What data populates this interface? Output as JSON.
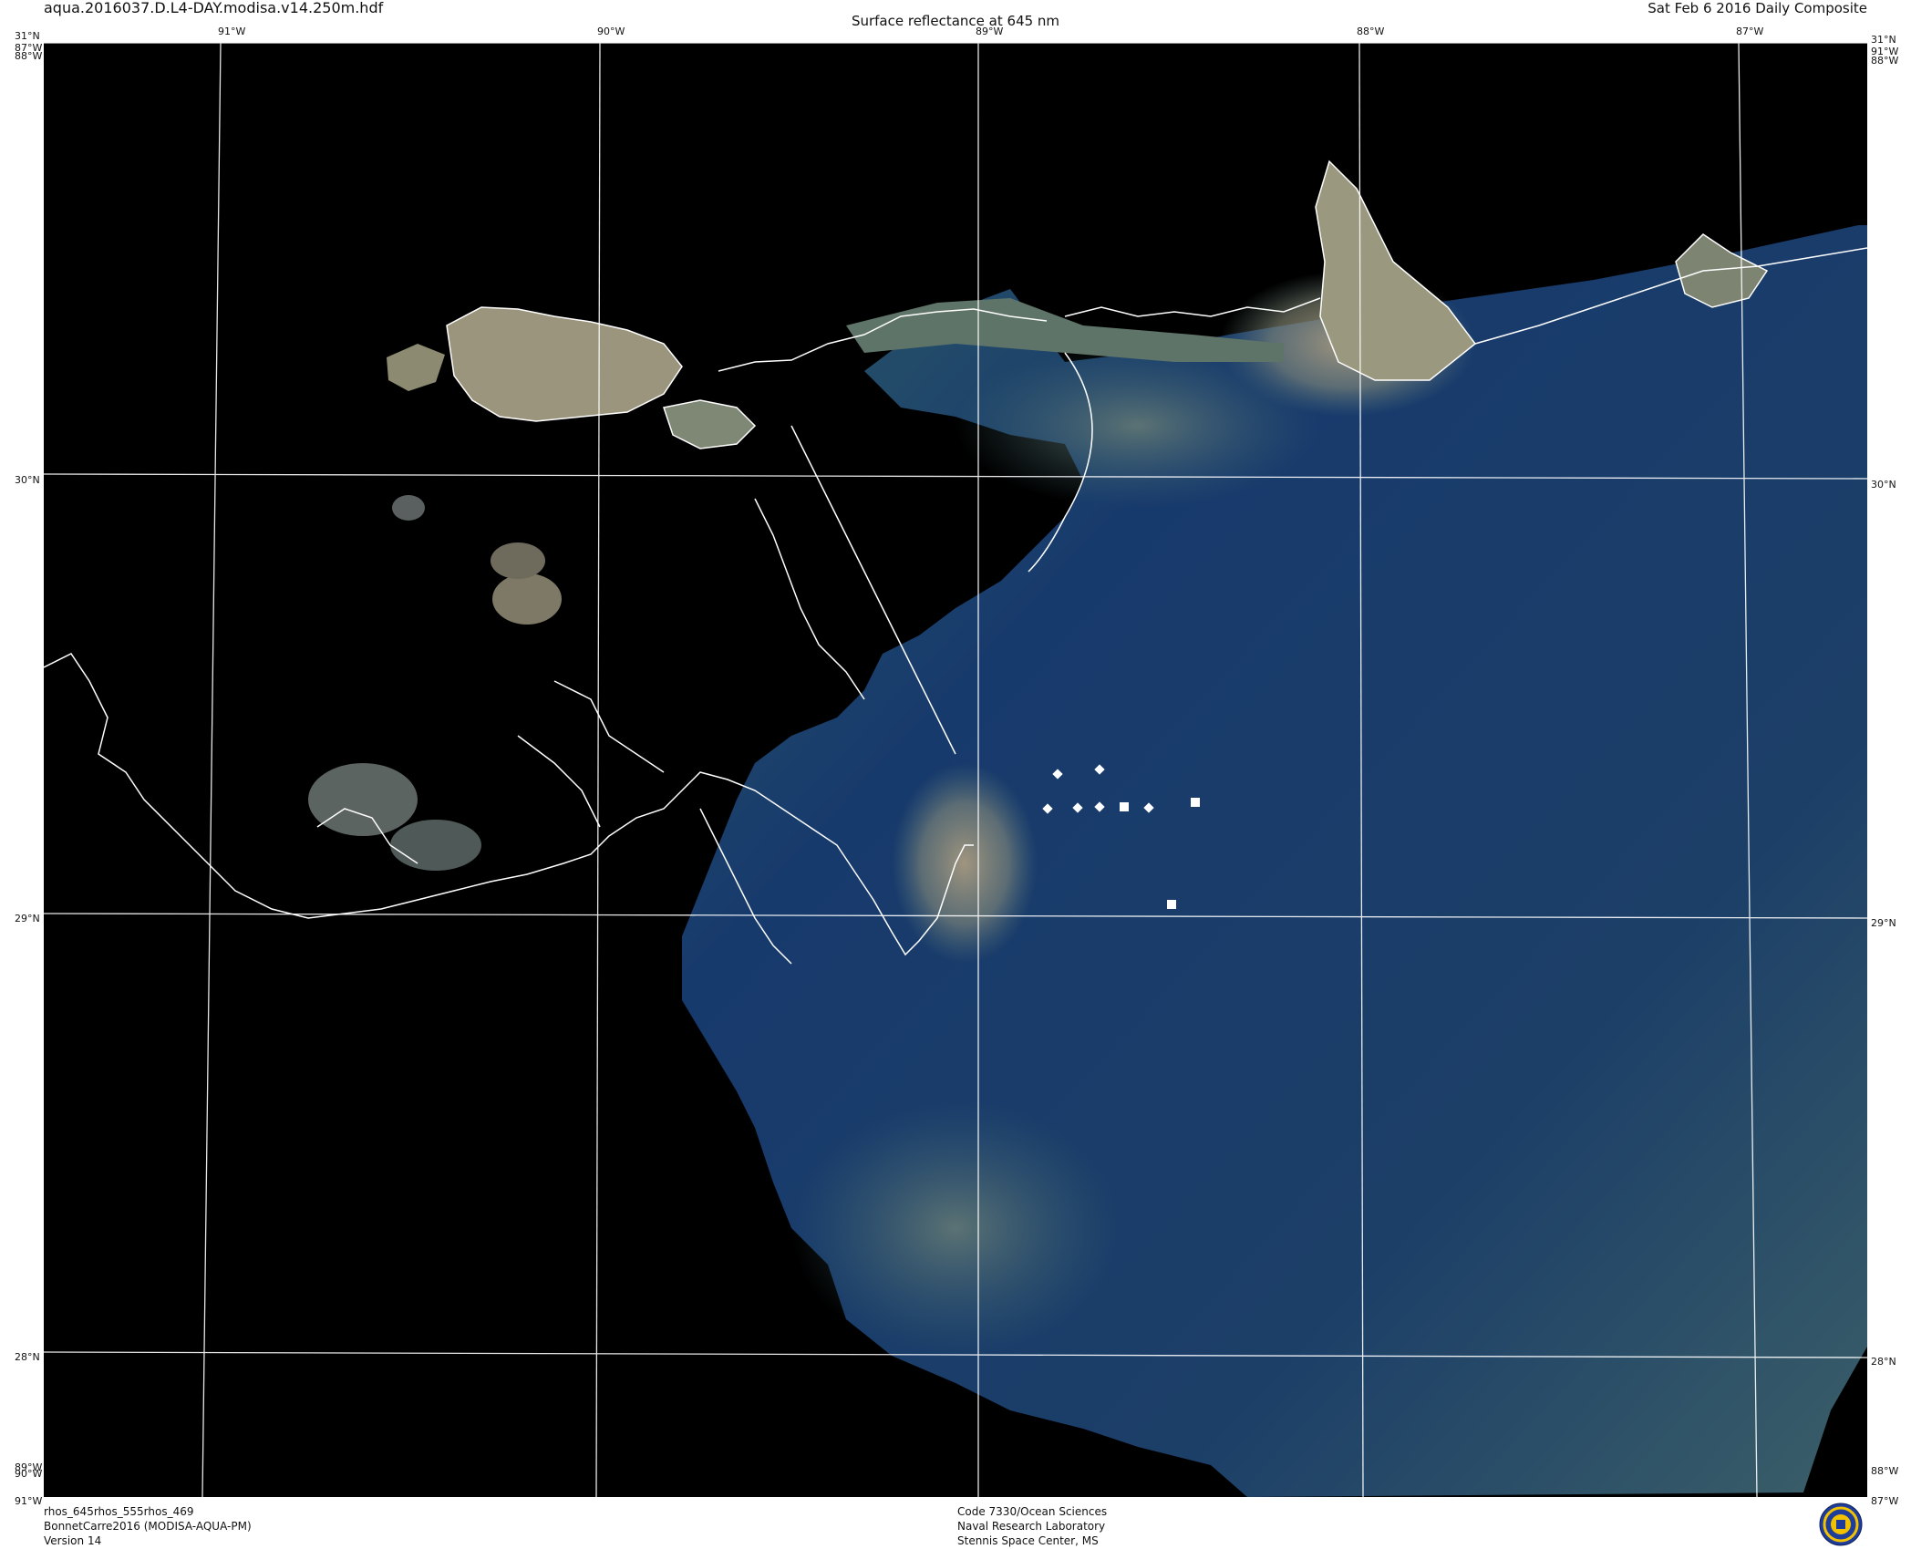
{
  "header": {
    "file_name": "aqua.2016037.D.L4-DAY.modisa.v14.250m.hdf",
    "title": "Surface reflectance at 645 nm",
    "date": "Sat Feb  6 2016 Daily Composite"
  },
  "map": {
    "longitude_labels_top": [
      "91°W",
      "90°W",
      "89°W",
      "88°W",
      "87°W"
    ],
    "latitude_labels": [
      "30°N",
      "29°N",
      "28°N"
    ],
    "corner_labels": {
      "top_left": [
        "31°N",
        "87°W",
        "88°W"
      ],
      "top_right": [
        "31°N",
        "91°W",
        "88°W"
      ],
      "bottom_left": [
        "89°W",
        "90°W",
        "91°W"
      ],
      "bottom_right": [
        "88°W",
        "87°W"
      ]
    },
    "colors": {
      "background": "#000000",
      "grid": "#ffffff",
      "coastline": "#ffffff"
    },
    "station_markers": {
      "diamonds": 6,
      "squares": 3
    }
  },
  "footer": {
    "left_lines": [
      "rhos_645rhos_555rhos_469",
      "BonnetCarre2016 (MODISA-AQUA-PM)",
      "Version 14"
    ],
    "center_lines": [
      "Code 7330/Ocean Sciences",
      "Naval Research Laboratory",
      "Stennis Space Center, MS"
    ]
  }
}
